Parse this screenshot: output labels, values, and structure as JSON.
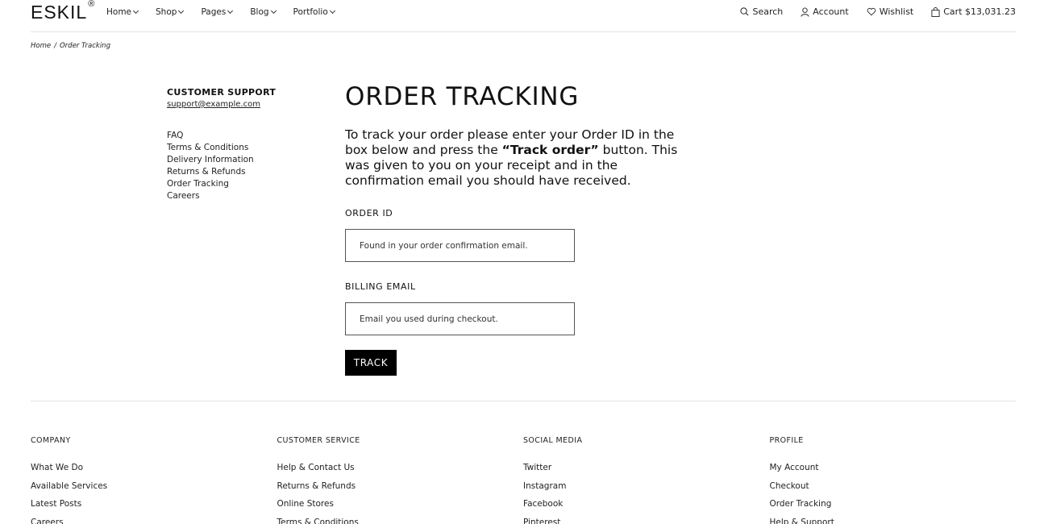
{
  "header": {
    "logo": "ESKIL",
    "logo_mark": "®",
    "nav": [
      {
        "label": "Home"
      },
      {
        "label": "Shop"
      },
      {
        "label": "Pages"
      },
      {
        "label": "Blog"
      },
      {
        "label": "Portfolio"
      }
    ],
    "search_label": "Search",
    "account_label": "Account",
    "wishlist_label": "Wishlist",
    "cart_label": "Cart $13,031.23"
  },
  "breadcrumb": {
    "home": "Home",
    "separator": "/",
    "current": "Order Tracking"
  },
  "sidebar": {
    "title": "CUSTOMER SUPPORT",
    "email": "support@example.com",
    "links": [
      "FAQ",
      "Terms & Conditions",
      "Delivery Information",
      "Returns & Refunds",
      "Order Tracking",
      "Careers"
    ]
  },
  "main": {
    "title": "ORDER TRACKING",
    "intro_before": "To track your order please enter your Order ID in the box below and press the ",
    "intro_bold": "“Track order”",
    "intro_after": " button. This was given to you on your receipt and in the confirmation email you should have received.",
    "order_id_label": "ORDER ID",
    "order_id_placeholder": "Found in your order confirmation email.",
    "billing_label": "BILLING EMAIL",
    "billing_placeholder": "Email you used during checkout.",
    "track_button": "TRACK"
  },
  "footer": {
    "columns": [
      {
        "heading": "COMPANY",
        "links": [
          "What We Do",
          "Available Services",
          "Latest Posts",
          "Careers"
        ]
      },
      {
        "heading": "CUSTOMER SERVICE",
        "links": [
          "Help & Contact Us",
          "Returns & Refunds",
          "Online Stores",
          "Terms & Conditions"
        ]
      },
      {
        "heading": "SOCIAL MEDIA",
        "links": [
          "Twitter",
          "Instagram",
          "Facebook",
          "Pinterest"
        ]
      },
      {
        "heading": "PROFILE",
        "links": [
          "My Account",
          "Checkout",
          "Order Tracking",
          "Help & Support"
        ]
      }
    ]
  }
}
